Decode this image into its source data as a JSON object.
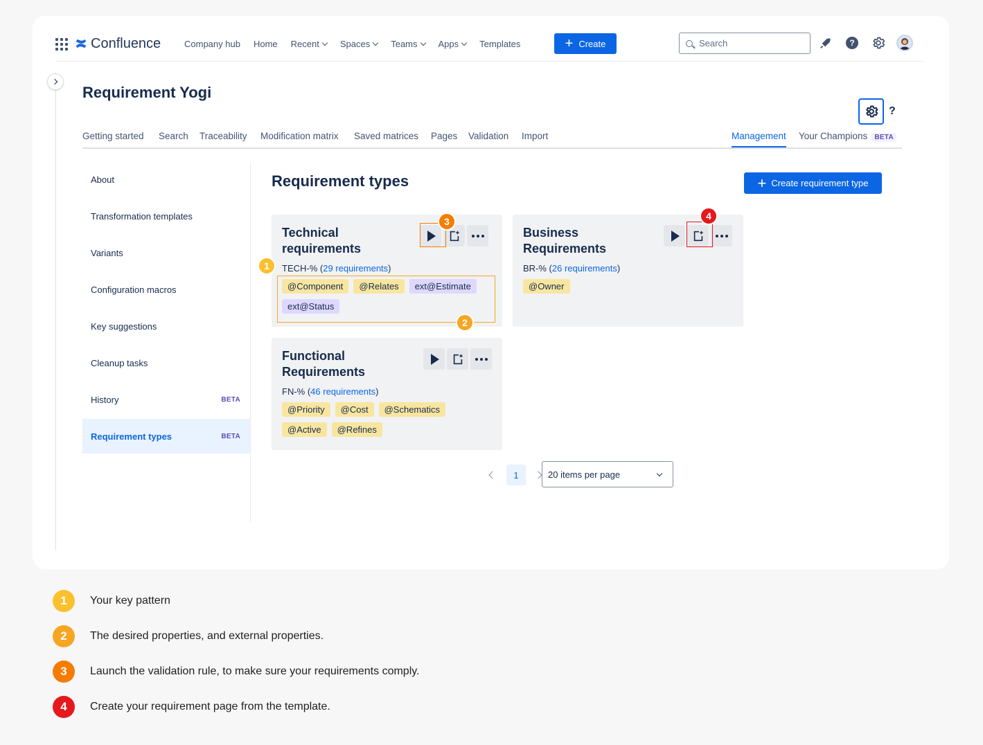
{
  "colors": {
    "primary": "#0c66e4",
    "badge1": "#fbc02d",
    "badge2": "#f5a623",
    "badge3": "#f57c00",
    "badge4": "#e5181e",
    "highlight_orange": "#f5a623",
    "highlight_red": "#e5181e"
  },
  "topnav": {
    "app_name": "Confluence",
    "items": [
      {
        "label": "Company hub",
        "dropdown": false
      },
      {
        "label": "Home",
        "dropdown": false
      },
      {
        "label": "Recent",
        "dropdown": true
      },
      {
        "label": "Spaces",
        "dropdown": true
      },
      {
        "label": "Teams",
        "dropdown": true
      },
      {
        "label": "Apps",
        "dropdown": true
      },
      {
        "label": "Templates",
        "dropdown": false
      }
    ],
    "create_label": "Create",
    "search_placeholder": "Search",
    "icons": [
      "notifications-icon",
      "help-icon",
      "settings-icon",
      "avatar"
    ]
  },
  "header": {
    "title": "Requirement Yogi",
    "help_label": "?"
  },
  "tabs": {
    "items": [
      "Getting started",
      "Search",
      "Traceability",
      "Modification matrix",
      "Saved matrices",
      "Pages",
      "Validation",
      "Import"
    ],
    "management": "Management",
    "champions": "Your Champions",
    "beta": "BETA"
  },
  "sidebar": {
    "items": [
      {
        "label": "About",
        "beta": "",
        "active": false
      },
      {
        "label": "Transformation templates",
        "beta": "",
        "active": false
      },
      {
        "label": "Variants",
        "beta": "",
        "active": false
      },
      {
        "label": "Configuration macros",
        "beta": "",
        "active": false
      },
      {
        "label": "Key suggestions",
        "beta": "",
        "active": false
      },
      {
        "label": "Cleanup tasks",
        "beta": "",
        "active": false
      },
      {
        "label": "History",
        "beta": "BETA",
        "active": false
      },
      {
        "label": "Requirement types",
        "beta": "BETA",
        "active": true
      }
    ]
  },
  "main": {
    "title": "Requirement types",
    "create_button": "Create requirement type",
    "cards": [
      {
        "title": "Technical requirements",
        "key_prefix": "TECH-% (",
        "count_link": "29 requirements",
        "key_suffix": ")",
        "properties": [
          {
            "label": "@Component",
            "kind": "int"
          },
          {
            "label": "@Relates",
            "kind": "int"
          },
          {
            "label": "ext@Estimate",
            "kind": "ext"
          },
          {
            "label": "ext@Status",
            "kind": "ext"
          }
        ]
      },
      {
        "title": "Business Requirements",
        "key_prefix": "BR-% (",
        "count_link": "26 requirements",
        "key_suffix": ")",
        "properties": [
          {
            "label": "@Owner",
            "kind": "int"
          }
        ]
      },
      {
        "title": "Functional Requirements",
        "key_prefix": "FN-% (",
        "count_link": "46 requirements",
        "key_suffix": ")",
        "properties": [
          {
            "label": "@Priority",
            "kind": "int"
          },
          {
            "label": "@Cost",
            "kind": "int"
          },
          {
            "label": "@Schematics",
            "kind": "int"
          },
          {
            "label": "@Active",
            "kind": "int"
          },
          {
            "label": "@Refines",
            "kind": "int"
          }
        ]
      }
    ],
    "pagination": {
      "current_page": "1",
      "per_page": "20 items per page"
    }
  },
  "annotations": {
    "badges": [
      "1",
      "2",
      "3",
      "4"
    ]
  },
  "legend": [
    {
      "num": "1",
      "text": "Your key pattern"
    },
    {
      "num": "2",
      "text": "The desired properties, and external properties."
    },
    {
      "num": "3",
      "text": "Launch the validation rule, to make sure your requirements comply."
    },
    {
      "num": "4",
      "text": "Create your requirement page from the template."
    }
  ]
}
